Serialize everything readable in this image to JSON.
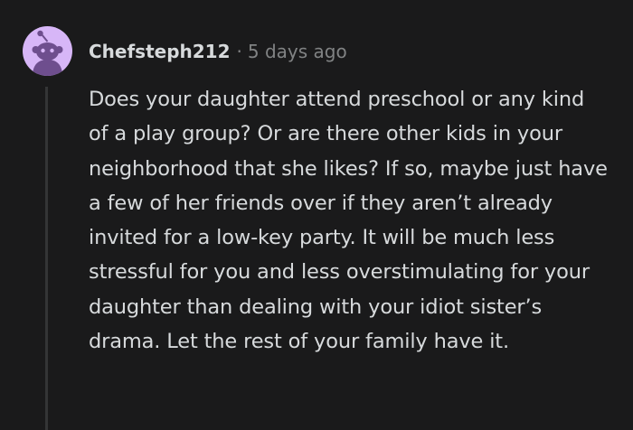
{
  "comment": {
    "author": "Chefsteph212",
    "separator": "·",
    "timestamp": "5 days ago",
    "body": "Does your daughter attend preschool or any kind of a play group? Or are there other kids in your neighborhood that she likes? If so, maybe just have a few of her friends over if they aren’t already invited for a low-key party. It will be much less stressful for you and less overstimulating for your daughter than dealing with your idiot sister’s drama. Let the rest of your family have it."
  },
  "colors": {
    "background": "#1a1a1b",
    "avatar_bg": "#d7b6f7",
    "avatar_figure": "#6e4e8e",
    "text": "#d7dadc",
    "meta_text": "#818384",
    "thread_line": "#343536"
  },
  "icons": {
    "avatar": "snoo-avatar-icon"
  }
}
